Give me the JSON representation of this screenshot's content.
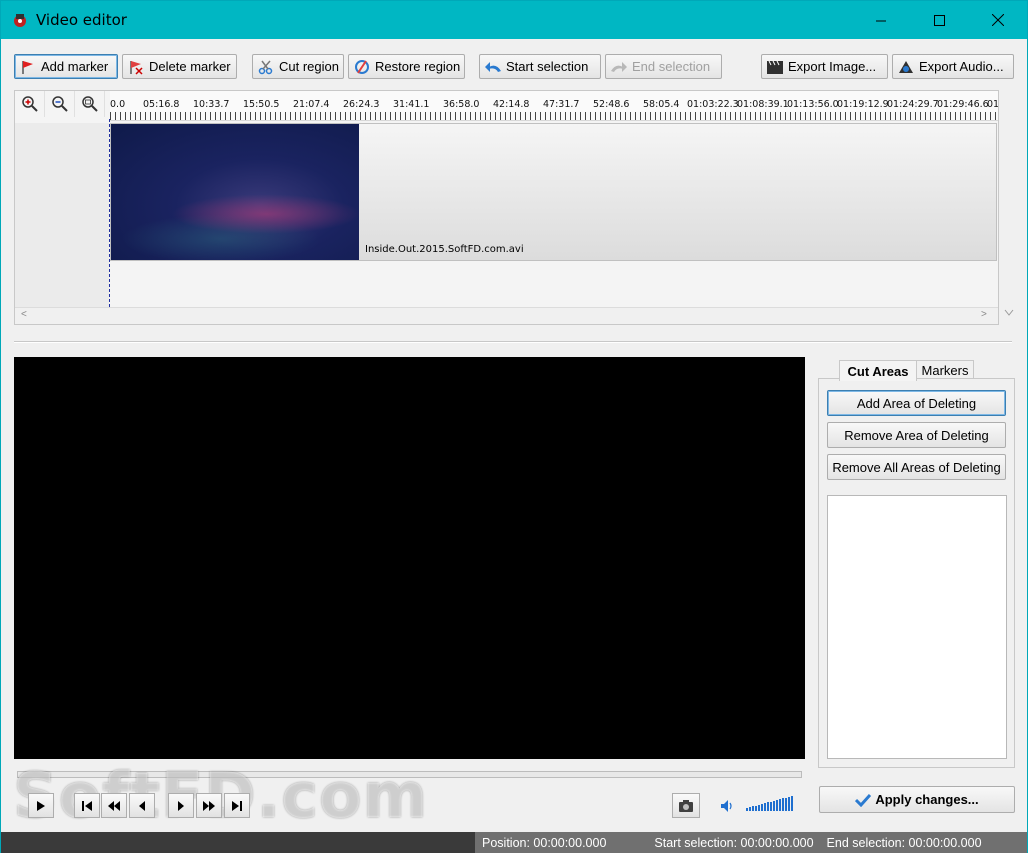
{
  "window": {
    "title": "Video editor"
  },
  "toolbar": {
    "add_marker": "Add marker",
    "delete_marker": "Delete marker",
    "cut_region": "Cut region",
    "restore_region": "Restore region",
    "start_selection": "Start selection",
    "end_selection": "End selection",
    "export_image": "Export Image...",
    "export_audio": "Export Audio..."
  },
  "timeline": {
    "ruler_labels": [
      "0.0",
      "05:16.8",
      "10:33.7",
      "15:50.5",
      "21:07.4",
      "26:24.3",
      "31:41.1",
      "36:58.0",
      "42:14.8",
      "47:31.7",
      "52:48.6",
      "58:05.4",
      "01:03:22.3",
      "01:08:39.1",
      "01:13:56.0",
      "01:19:12.9",
      "01:24:29.7",
      "01:29:46.6",
      "01"
    ],
    "clip_name": "Inside.Out.2015.SoftFD.com.avi",
    "hscroll_left": "<",
    "hscroll_right": ">"
  },
  "side_panel": {
    "tabs": [
      "Cut Areas",
      "Markers"
    ],
    "add_area": "Add Area of Deleting",
    "remove_area": "Remove Area of Deleting",
    "remove_all_areas": "Remove All Areas of Deleting"
  },
  "apply_button": "Apply changes...",
  "watermark": "SoftFD.com",
  "status": {
    "position": "Position: 00:00:00.000",
    "start_selection": "Start selection: 00:00:00.000",
    "end_selection": "End selection: 00:00:00.000"
  },
  "colors": {
    "titlebar": "#00b7c3",
    "accent_blue": "#1f6fcf"
  }
}
